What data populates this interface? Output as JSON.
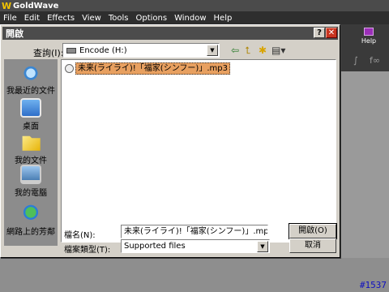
{
  "app": {
    "title": "GoldWave",
    "menu": [
      "File",
      "Edit",
      "Effects",
      "View",
      "Tools",
      "Options",
      "Window",
      "Help"
    ],
    "toolbar": {
      "help_label": "Help",
      "glyph_a": "∫",
      "glyph_b": "f∞"
    }
  },
  "dialog": {
    "title": "開啟",
    "look_in_label": "查詢(I):",
    "look_in_value": "Encode (H:)",
    "places": [
      {
        "label": "我最近的文件",
        "icon": "recent-documents-icon"
      },
      {
        "label": "桌面",
        "icon": "desktop-icon"
      },
      {
        "label": "我的文件",
        "icon": "my-documents-icon"
      },
      {
        "label": "我的電腦",
        "icon": "my-computer-icon"
      },
      {
        "label": "網路上的芳鄰",
        "icon": "network-places-icon"
      }
    ],
    "files": [
      {
        "name": "未来(ライライ)!「福家(シンフー)」.mp3",
        "selected": true
      }
    ],
    "filename_label": "檔名(N):",
    "filename_value": "未来(ライライ)!「福家(シンフー)」.mp3",
    "filetype_label": "檔案類型(T):",
    "filetype_value": "Supported files",
    "open_button": "開啟(O)",
    "cancel_button": "取消"
  },
  "watermark": "#1537",
  "colors": {
    "selection": "#e8a060",
    "titlebar": "#4c4c4c",
    "close": "#c9341f"
  }
}
